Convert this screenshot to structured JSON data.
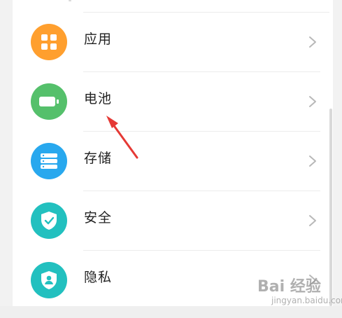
{
  "settings": {
    "items": [
      {
        "label": "应用",
        "icon": "apps-grid-icon",
        "color": "#ff9f2e"
      },
      {
        "label": "电池",
        "icon": "battery-icon",
        "color": "#55c06b"
      },
      {
        "label": "存储",
        "icon": "storage-icon",
        "color": "#28a8ee"
      },
      {
        "label": "安全",
        "icon": "security-shield-icon",
        "color": "#22c0bf"
      },
      {
        "label": "隐私",
        "icon": "privacy-shield-icon",
        "color": "#22c0bf"
      }
    ]
  },
  "annotation": {
    "color": "#e53935"
  },
  "watermark": {
    "main": "Bai 经验",
    "sub": "jingyan.baidu.com"
  }
}
